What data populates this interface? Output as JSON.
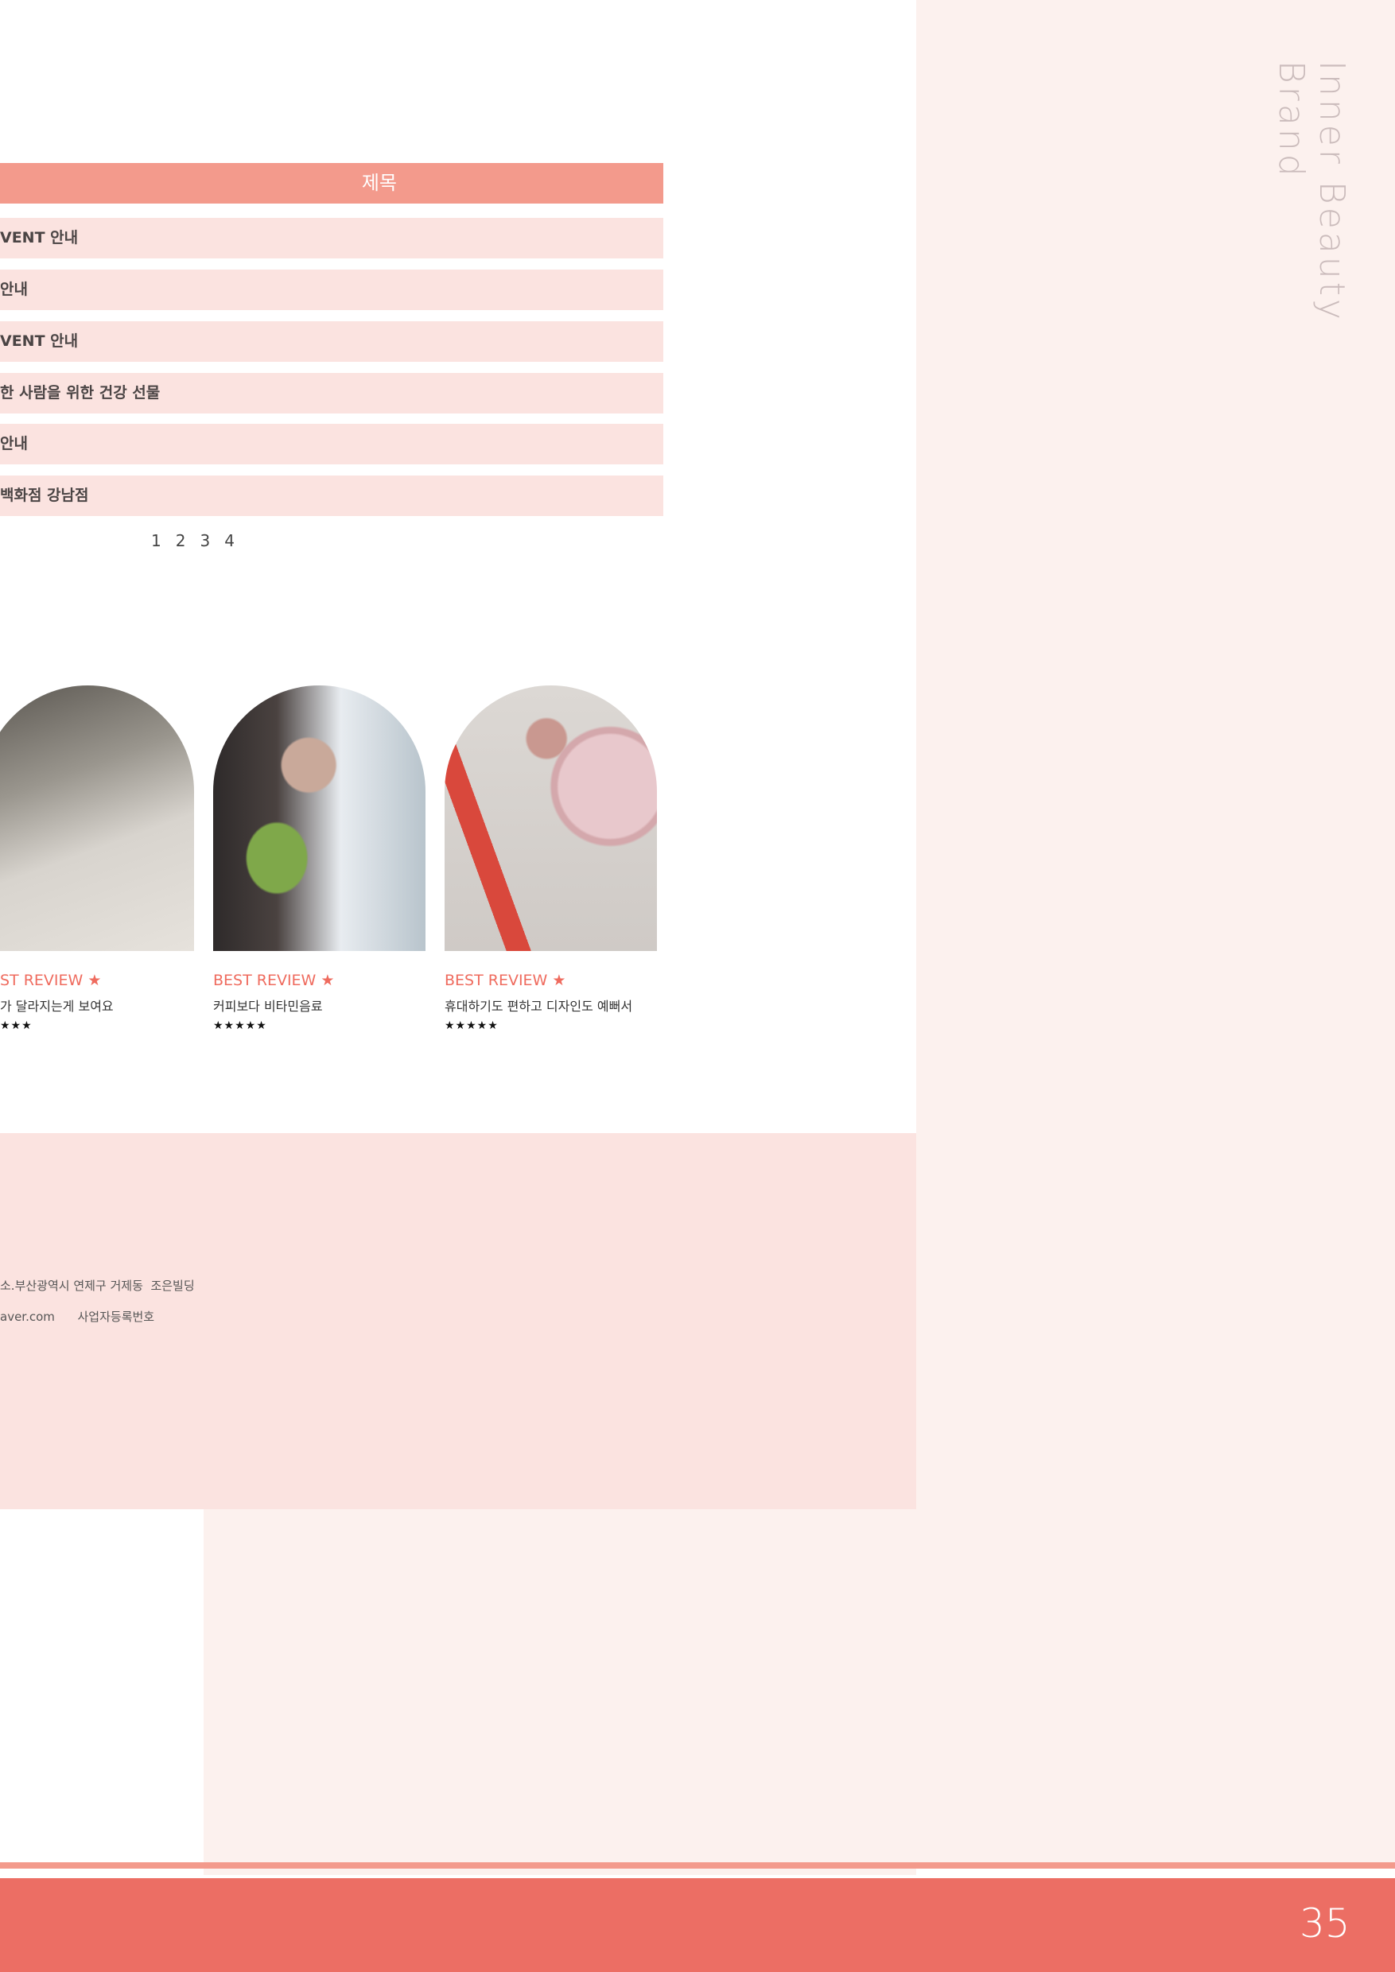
{
  "side": {
    "brand": "Inner Beauty Brand"
  },
  "board": {
    "header": "제목",
    "rows": [
      "VENT 안내",
      "안내",
      "VENT 안내",
      "한 사람을 위한 건강 선물",
      "안내",
      "백화점 강남점"
    ],
    "pages": [
      "1",
      "2",
      "3",
      "4"
    ]
  },
  "reviews": [
    {
      "label": "ST REVIEW ★",
      "text": "가 달라지는게 보여요",
      "stars": "★★★"
    },
    {
      "label": "BEST REVIEW ★",
      "text": "커피보다 비타민음료",
      "stars": "★★★★★"
    },
    {
      "label": "BEST REVIEW ★",
      "text": "휴대하기도 편하고 디자인도 예뻐서",
      "stars": "★★★★★"
    }
  ],
  "footer": {
    "address": "소.부산광역시 연제구 거제동  조은빌딩",
    "contact": "aver.com      사업자등록번호"
  },
  "page_number": "35",
  "colors": {
    "accent": "#ec6e64",
    "header": "#f39a8c",
    "row": "#fbe3e0",
    "panel": "#fcf1ee"
  }
}
